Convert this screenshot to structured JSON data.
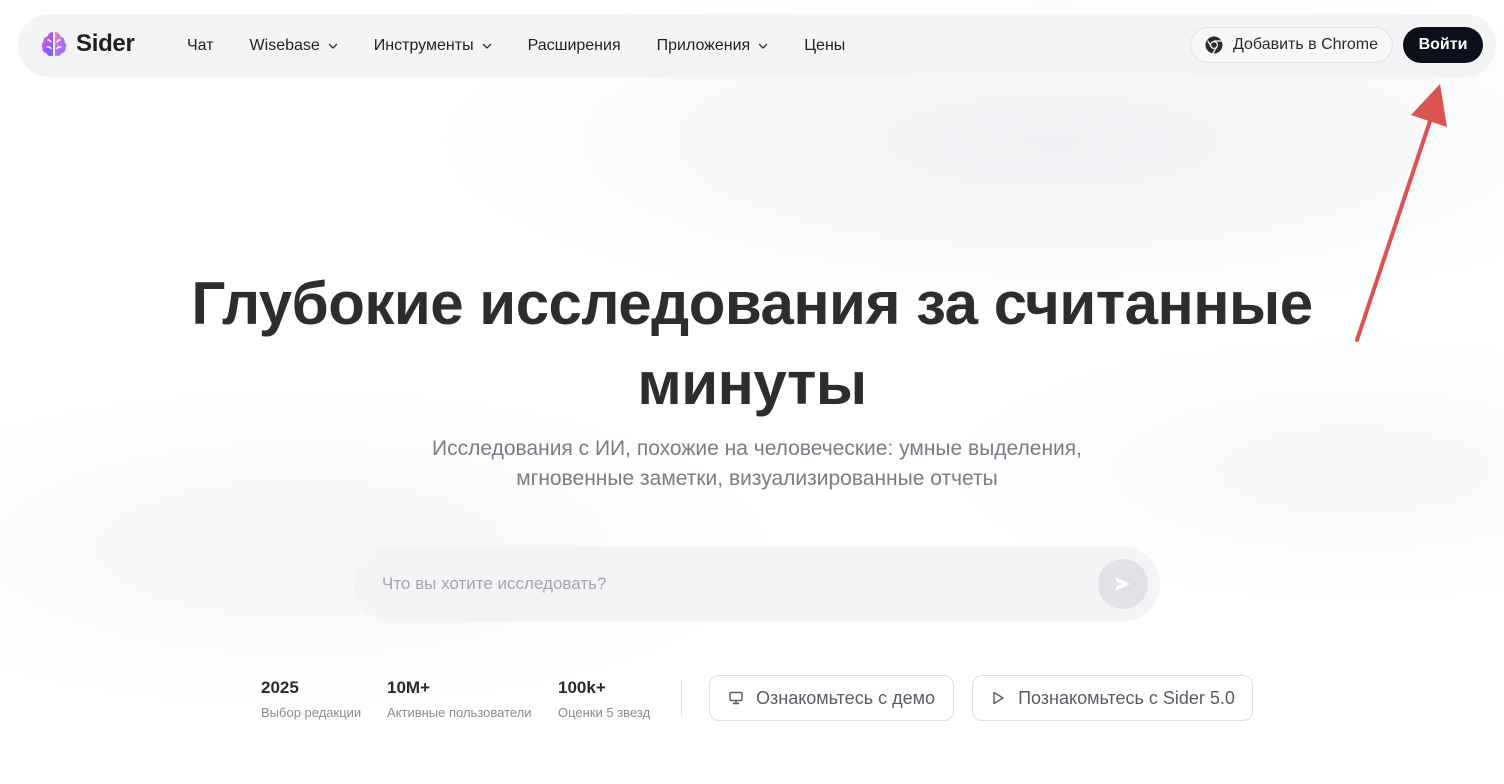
{
  "brand": {
    "name": "Sider",
    "logo_icon": "brain-icon",
    "colors": {
      "accent_dark": "#0d0f1c",
      "logo_purple": "#8b5cf6",
      "logo_pink": "#ec4899",
      "logo_blue": "#6366f1"
    }
  },
  "nav": {
    "items": [
      {
        "label": "Чат",
        "has_dropdown": false
      },
      {
        "label": "Wisebase",
        "has_dropdown": true
      },
      {
        "label": "Инструменты",
        "has_dropdown": true
      },
      {
        "label": "Расширения",
        "has_dropdown": false
      },
      {
        "label": "Приложения",
        "has_dropdown": true
      },
      {
        "label": "Цены",
        "has_dropdown": false
      }
    ],
    "chrome_button": {
      "label": "Добавить в Chrome",
      "icon": "chrome-icon"
    },
    "login_button": {
      "label": "Войти"
    }
  },
  "hero": {
    "title_line1": "Глубокие исследования за считанные",
    "title_line2": "минуты",
    "subtitle_line1": "Исследования с ИИ, похожие на человеческие: умные выделения,",
    "subtitle_line2": "мгновенные заметки, визуализированные отчеты"
  },
  "search": {
    "value": "",
    "placeholder": "Что вы хотите исследовать?",
    "send_icon": "send-icon"
  },
  "stats": [
    {
      "value": "2025",
      "label": "Выбор редакции"
    },
    {
      "value": "10M+",
      "label": "Активные пользователи"
    },
    {
      "value": "100k+",
      "label": "Оценки 5 звезд"
    }
  ],
  "buttons": {
    "demo": {
      "label": "Ознакомьтесь с демо",
      "icon": "monitor-icon"
    },
    "sider5": {
      "label": "Познакомьтесь с Sider 5.0",
      "icon": "play-icon"
    }
  },
  "annotation": {
    "type": "arrow",
    "color": "#d9534f",
    "points_to": "login-button"
  }
}
